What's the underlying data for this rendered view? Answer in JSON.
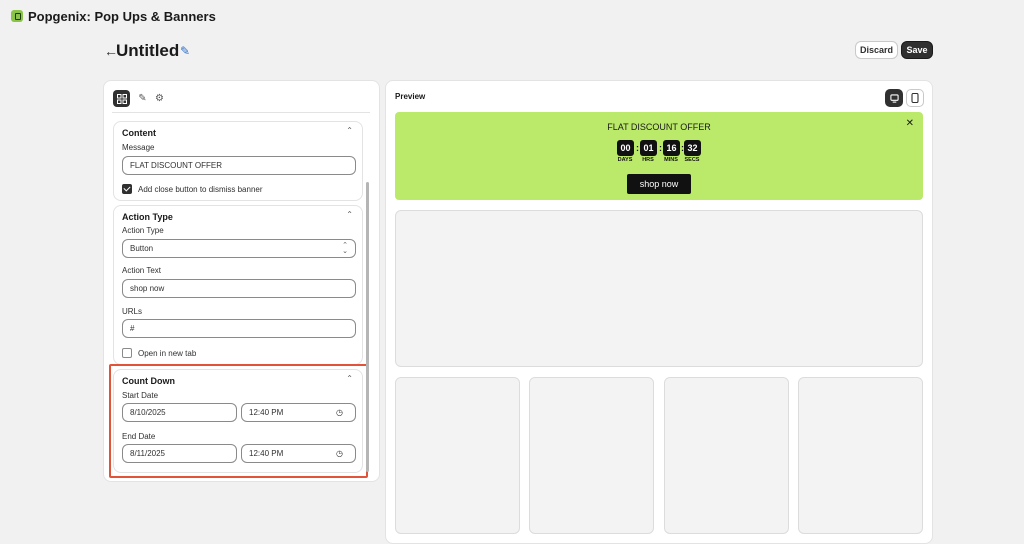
{
  "app": {
    "title": "Popgenix: Pop Ups & Banners",
    "logo_icon": "popgenix-logo-icon"
  },
  "header": {
    "title": "Untitled",
    "discard_label": "Discard",
    "save_label": "Save"
  },
  "editor": {
    "tools": [
      "layout-icon",
      "pencil-icon",
      "gear-icon"
    ],
    "content": {
      "heading": "Content",
      "message_label": "Message",
      "message_value": "FLAT DISCOUNT OFFER",
      "close_checkbox_label": "Add close button to dismiss banner",
      "close_checked": true
    },
    "action": {
      "heading": "Action Type",
      "type_label": "Action Type",
      "type_value": "Button",
      "text_label": "Action Text",
      "text_value": "shop now",
      "urls_label": "URLs",
      "urls_value": "#",
      "new_tab_label": "Open in new tab",
      "new_tab_checked": false
    },
    "countdown": {
      "heading": "Count Down",
      "start_label": "Start Date",
      "start_date": "8/10/2025",
      "start_time": "12:40 PM",
      "end_label": "End Date",
      "end_date": "8/11/2025",
      "end_time": "12:40 PM"
    }
  },
  "preview": {
    "label": "Preview",
    "banner": {
      "message": "FLAT DISCOUNT OFFER",
      "background": "#bbe96a",
      "countdown": [
        {
          "value": "00",
          "unit": "DAYS"
        },
        {
          "value": "01",
          "unit": "HRS"
        },
        {
          "value": "16",
          "unit": "MINS"
        },
        {
          "value": "32",
          "unit": "SECS"
        }
      ],
      "cta": "shop now"
    }
  },
  "colors": {
    "highlight": "#e0553a",
    "primary": "#303030"
  }
}
